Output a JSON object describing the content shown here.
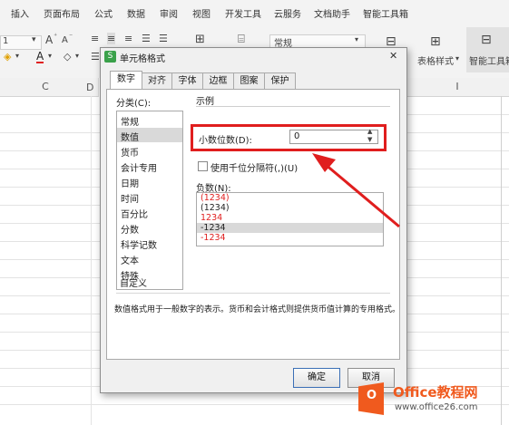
{
  "ribbon": {
    "tabs": [
      "插入",
      "页面布局",
      "公式",
      "数据",
      "审阅",
      "视图",
      "开发工具",
      "云服务",
      "文档助手",
      "智能工具箱"
    ]
  },
  "toolbar": {
    "font_size_fragment": "1",
    "number_format_value": "常规",
    "table_style_label": "表格样式",
    "smart_toolbox_label": "智能工具箱",
    "font_grow": "A",
    "font_shrink": "A",
    "font_color": "A"
  },
  "sheet": {
    "columns": [
      "C",
      "D",
      "I"
    ]
  },
  "dialog": {
    "title": "单元格格式",
    "close": "✕",
    "tabs": [
      "数字",
      "对齐",
      "字体",
      "边框",
      "图案",
      "保护"
    ],
    "category_label": "分类(C):",
    "categories": [
      "常规",
      "数值",
      "货币",
      "会计专用",
      "日期",
      "时间",
      "百分比",
      "分数",
      "科学记数",
      "文本",
      "特殊",
      "自定义"
    ],
    "sample_label": "示例",
    "decimal_label": "小数位数(D):",
    "decimal_value": "0",
    "thousands_label": "使用千位分隔符(,)(U)",
    "negative_label": "负数(N):",
    "negative_options": [
      "(1234)",
      "(1234)",
      "1234",
      "-1234",
      "-1234"
    ],
    "description": "数值格式用于一般数字的表示。货币和会计格式则提供货币值计算的专用格式。",
    "ok_label": "确定",
    "cancel_label": "取消"
  },
  "watermark": {
    "brand": "Office教程网",
    "url": "www.office26.com"
  },
  "colors": {
    "highlight_red": "#e01e1e",
    "negative_red": "#e02020",
    "logo_orange": "#f05a1e",
    "selection_gray": "#d9d9d9"
  }
}
